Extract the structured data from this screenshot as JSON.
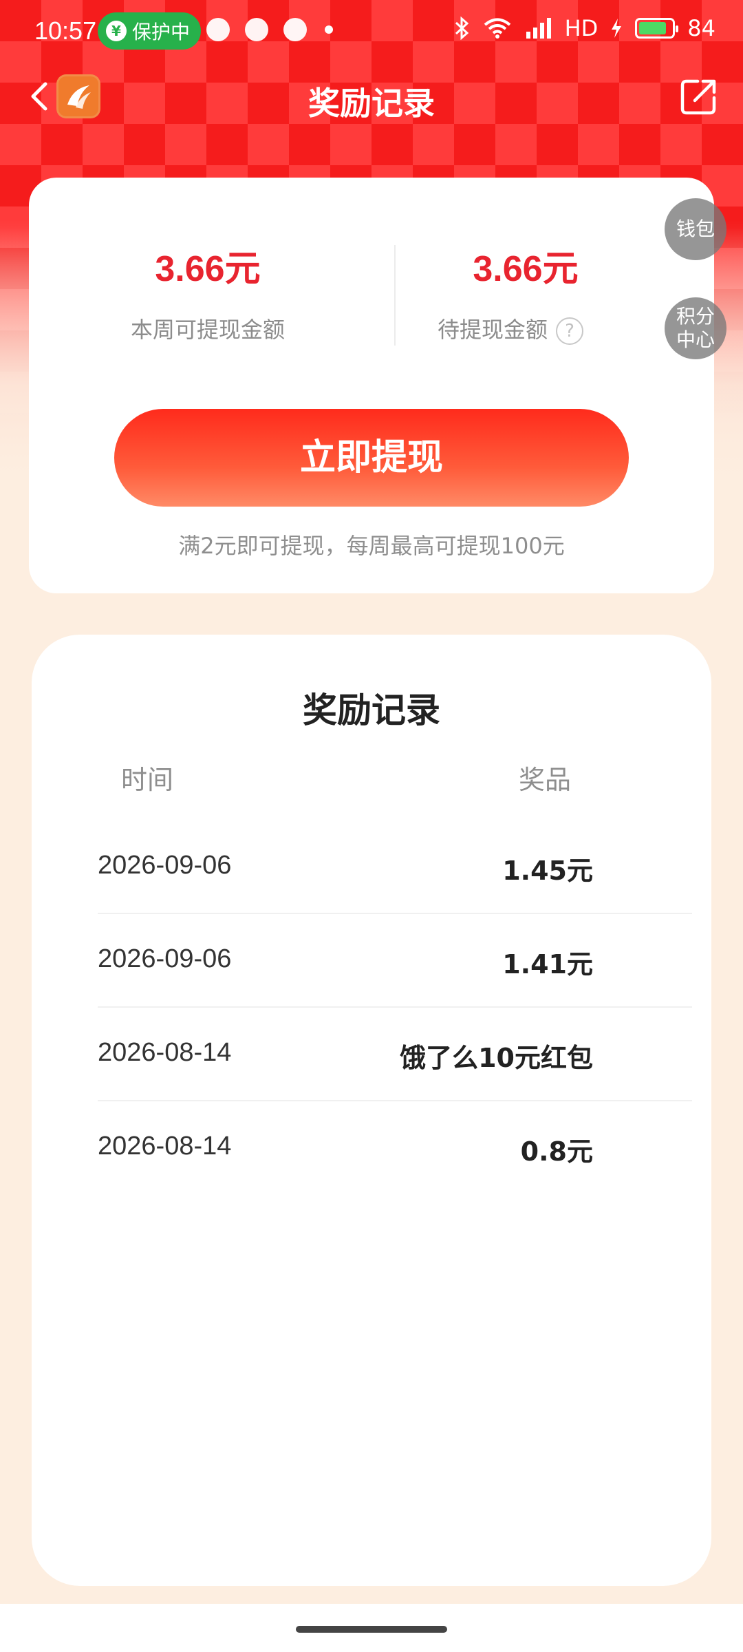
{
  "status_bar": {
    "time": "10:57",
    "protect_label": "保护中",
    "network": "HD",
    "battery": "84",
    "icons": [
      "message-icon",
      "weibo-icon",
      "chat-icon",
      "dot-icon",
      "bluetooth-icon",
      "wifi-icon",
      "signal-5g-icon",
      "charging-icon",
      "battery-icon"
    ]
  },
  "nav": {
    "title": "奖励记录",
    "icons": [
      "back-icon",
      "app-logo-icon",
      "share-icon"
    ]
  },
  "summary": {
    "week_amount": "3.66元",
    "week_label": "本周可提现金额",
    "pending_amount": "3.66元",
    "pending_label": "待提现金额",
    "help_symbol": "?",
    "withdraw_button": "立即提现",
    "note": "满2元即可提现，每周最高可提现100元"
  },
  "side_buttons": {
    "wallet": "钱包",
    "points_line1": "积分",
    "points_line2": "中心"
  },
  "records": {
    "title": "奖励记录",
    "col_time": "时间",
    "col_prize": "奖品",
    "rows": [
      {
        "date": "2026-09-06",
        "prize": "1.45元"
      },
      {
        "date": "2026-09-06",
        "prize": "1.41元"
      },
      {
        "date": "2026-08-14",
        "prize": "饿了么10元红包"
      },
      {
        "date": "2026-08-14",
        "prize": "0.8元"
      }
    ]
  },
  "colors": {
    "accent_red": "#e8242f",
    "button_gradient_top": "#ff2b1c",
    "button_gradient_bottom": "#ff8a66",
    "page_bg": "#fdeee0",
    "protect_green": "#27b14b"
  }
}
